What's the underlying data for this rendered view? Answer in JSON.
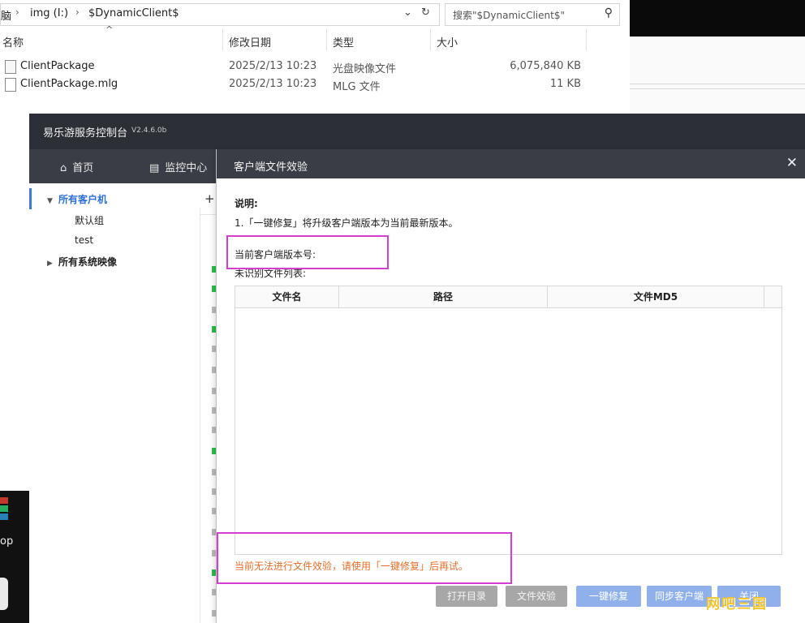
{
  "explorer": {
    "path": [
      "脑",
      "img (I:)",
      "$DynamicClient$"
    ],
    "search_placeholder": "搜索\"$DynamicClient$\"",
    "columns": [
      "名称",
      "修改日期",
      "类型",
      "大小"
    ],
    "files": [
      {
        "name": "ClientPackage",
        "date": "2025/2/13 10:23",
        "type": "光盘映像文件",
        "size": "6,075,840 KB"
      },
      {
        "name": "ClientPackage.mlg",
        "date": "2025/2/13 10:23",
        "type": "MLG 文件",
        "size": "11 KB"
      }
    ]
  },
  "taskbar_fragment": "op",
  "app": {
    "title": "易乐游服务控制台",
    "version": "V2.4.6.0b",
    "nav": [
      {
        "label": "首页",
        "icon": "home-icon"
      },
      {
        "label": "监控中心",
        "icon": "monitor-icon"
      }
    ],
    "tree": [
      {
        "label": "所有客户机",
        "level": 0,
        "expanded": true,
        "selected": true
      },
      {
        "label": "默认组",
        "level": 1
      },
      {
        "label": "test",
        "level": 1
      },
      {
        "label": "所有系统映像",
        "level": 0,
        "expanded": false
      }
    ],
    "add_symbol": "+"
  },
  "dialog": {
    "title": "客户端文件效验",
    "close_symbol": "✕",
    "note_heading": "说明:",
    "note_line": "1.「一键修复」将升级客户端版本为当前最新版本。",
    "version_label": "当前客户端版本号:",
    "list_label": "未识别文件列表:",
    "table_headers": [
      "文件名",
      "路径",
      "文件MD5"
    ],
    "error_message": "当前无法进行文件效验，请使用「一键修复」后再试。",
    "buttons": [
      "打开目录",
      "文件效验",
      "一键修复",
      "同步客户端",
      "关闭"
    ]
  },
  "watermark": "网吧三国",
  "colors": {
    "titlebar": "#2c2f36",
    "nav": "#3a3d45",
    "accent": "#3a7bd5",
    "highlight": "#d23fd1",
    "error": "#e2702c"
  }
}
